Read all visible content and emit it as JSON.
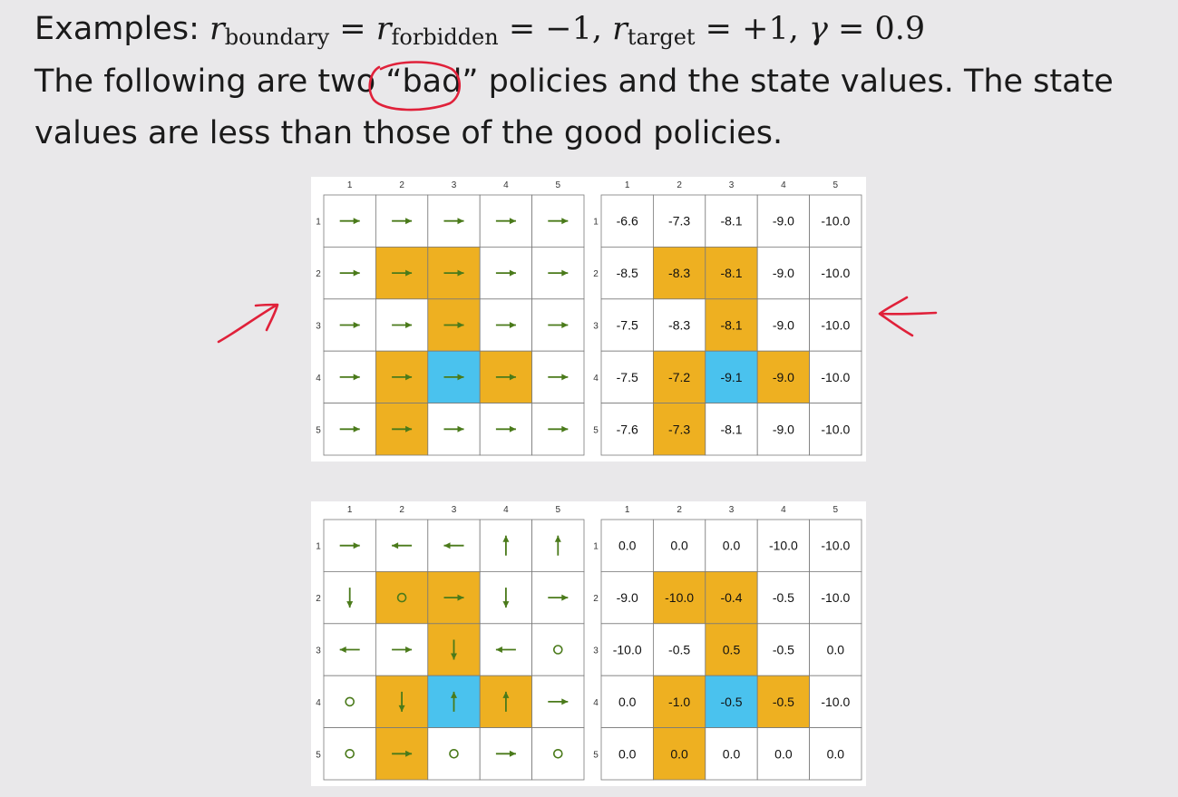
{
  "text": {
    "line1_prefix": "Examples: ",
    "r_symbol": "r",
    "sub_boundary": "boundary",
    "sub_forbidden": "forbidden",
    "sub_target": "target",
    "equals": " = ",
    "minus_one": "−1",
    "plus_one": "+1",
    "comma": ", ",
    "gamma_symbol": "γ",
    "gamma_value": "0.9",
    "line2_before": "The following are two ",
    "line2_quoted": "“bad”",
    "line2_after": " policies and the state values. The state",
    "line3": "values are less than those of the good policies."
  },
  "colors": {
    "forbidden": "#eeb021",
    "target": "#4ac2ee",
    "arrow": "#4a7a1a",
    "grid_line": "#7a7a7a",
    "annotation": "#e0213a"
  },
  "grid_labels": {
    "cols": [
      "1",
      "2",
      "3",
      "4",
      "5"
    ],
    "rows": [
      "1",
      "2",
      "3",
      "4",
      "5"
    ]
  },
  "panels": [
    {
      "id": "policy1",
      "cells": [
        [
          "white",
          "white",
          "white",
          "white",
          "white"
        ],
        [
          "white",
          "forbidden",
          "forbidden",
          "white",
          "white"
        ],
        [
          "white",
          "white",
          "forbidden",
          "white",
          "white"
        ],
        [
          "white",
          "forbidden",
          "target",
          "forbidden",
          "white"
        ],
        [
          "white",
          "forbidden",
          "white",
          "white",
          "white"
        ]
      ],
      "actions": [
        [
          "right",
          "right",
          "right",
          "right",
          "right"
        ],
        [
          "right",
          "right",
          "right",
          "right",
          "right"
        ],
        [
          "right",
          "right",
          "right",
          "right",
          "right"
        ],
        [
          "right",
          "right",
          "right",
          "right",
          "right"
        ],
        [
          "right",
          "right",
          "right",
          "right",
          "right"
        ]
      ],
      "values": [
        [
          "-6.6",
          "-7.3",
          "-8.1",
          "-9.0",
          "-10.0"
        ],
        [
          "-8.5",
          "-8.3",
          "-8.1",
          "-9.0",
          "-10.0"
        ],
        [
          "-7.5",
          "-8.3",
          "-8.1",
          "-9.0",
          "-10.0"
        ],
        [
          "-7.5",
          "-7.2",
          "-9.1",
          "-9.0",
          "-10.0"
        ],
        [
          "-7.6",
          "-7.3",
          "-8.1",
          "-9.0",
          "-10.0"
        ]
      ]
    },
    {
      "id": "policy2",
      "cells": [
        [
          "white",
          "white",
          "white",
          "white",
          "white"
        ],
        [
          "white",
          "forbidden",
          "forbidden",
          "white",
          "white"
        ],
        [
          "white",
          "white",
          "forbidden",
          "white",
          "white"
        ],
        [
          "white",
          "forbidden",
          "target",
          "forbidden",
          "white"
        ],
        [
          "white",
          "forbidden",
          "white",
          "white",
          "white"
        ]
      ],
      "actions": [
        [
          "right",
          "left",
          "left",
          "up",
          "up"
        ],
        [
          "down",
          "stay",
          "right",
          "down",
          "right"
        ],
        [
          "left",
          "right",
          "down",
          "left",
          "stay"
        ],
        [
          "stay",
          "down",
          "up",
          "up",
          "right"
        ],
        [
          "stay",
          "right",
          "stay",
          "right",
          "stay"
        ]
      ],
      "values": [
        [
          "0.0",
          "0.0",
          "0.0",
          "-10.0",
          "-10.0"
        ],
        [
          "-9.0",
          "-10.0",
          "-0.4",
          "-0.5",
          "-10.0"
        ],
        [
          "-10.0",
          "-0.5",
          "0.5",
          "-0.5",
          "0.0"
        ],
        [
          "0.0",
          "-1.0",
          "-0.5",
          "-0.5",
          "-10.0"
        ],
        [
          "0.0",
          "0.0",
          "0.0",
          "0.0",
          "0.0"
        ]
      ]
    }
  ]
}
